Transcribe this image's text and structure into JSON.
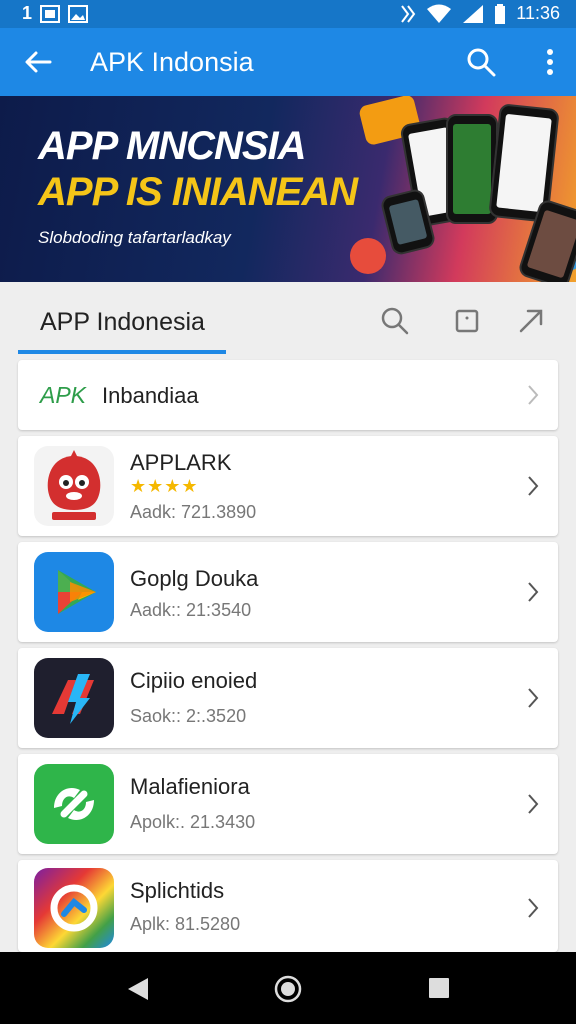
{
  "status_bar": {
    "left_text": "1",
    "time": "11:36"
  },
  "app_bar": {
    "title": "APK Indonsia"
  },
  "banner": {
    "line1": "APP MNCNSIA",
    "line2": "APP IS INIANEAN",
    "line3": "Slobdoding tafartarladkay"
  },
  "section": {
    "title": "APP Indonesia"
  },
  "top_item": {
    "brand": "APK",
    "label": "Inbandiaa"
  },
  "apps": [
    {
      "name": "APPLARK",
      "sub": "Aadk: 721.3890",
      "stars": "★★★★",
      "icon": "red-mascot-icon"
    },
    {
      "name": "Goplg Douka",
      "sub": "Aadk:: 21:3540",
      "icon": "play-store-icon"
    },
    {
      "name": "Cipiio enoied",
      "sub": "Saok:: 2:.3520",
      "icon": "dark-lightning-icon"
    },
    {
      "name": "Malafieniora",
      "sub": "Apolk:. 21.3430",
      "icon": "green-swirl-icon"
    },
    {
      "name": "Splichtids",
      "sub": "Aplk: 81.5280",
      "icon": "colorful-swirl-icon"
    }
  ],
  "colors": {
    "primary": "#1e88e5",
    "status": "#1676c8",
    "accent_yellow": "#f5c518"
  }
}
